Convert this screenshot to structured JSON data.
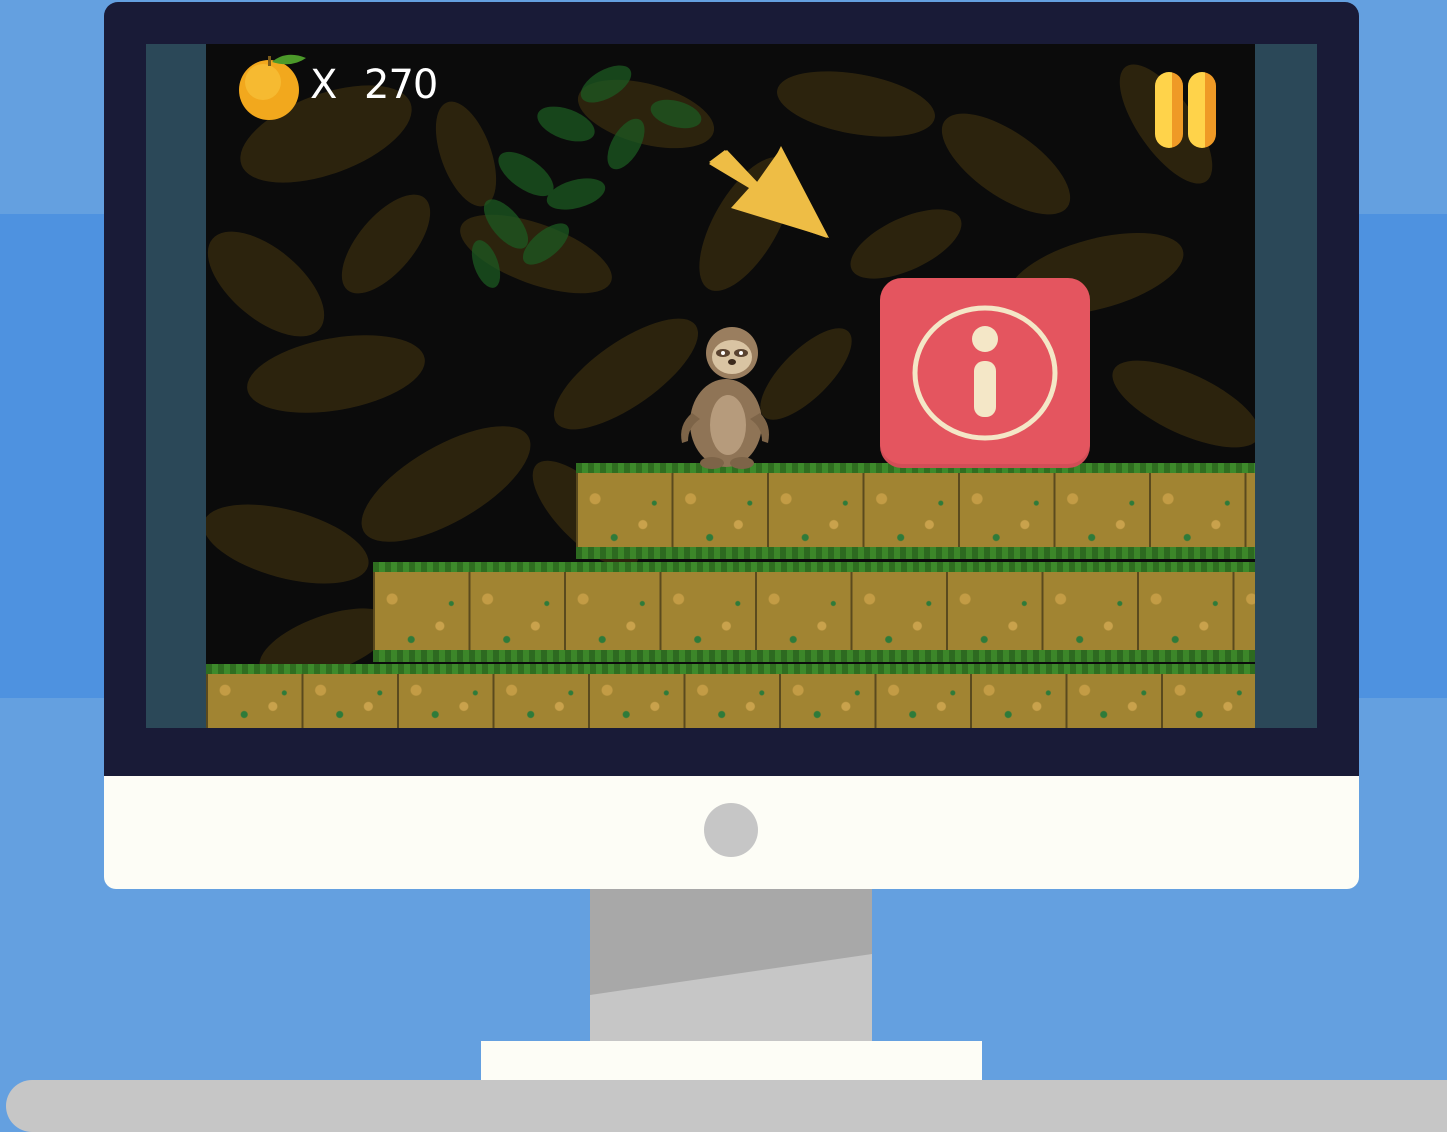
{
  "colors": {
    "background_light": "#64a0e0",
    "background_band": "#4e92e0",
    "bezel": "#191b37",
    "chin": "#fdfdf6",
    "stand": "#c6c6c6",
    "screen_margin": "#2b4858",
    "info_button": "#e4555f",
    "arrow": "#eebd45",
    "pause": "#ffc83a"
  },
  "hud": {
    "fruit_icon": "orange-icon",
    "multiplier": "X",
    "score": "270",
    "pause_icon": "pause-icon"
  },
  "overlay": {
    "arrow_icon": "arrow-down-right-icon",
    "info_icon": "info-icon"
  },
  "player": {
    "character": "sloth"
  }
}
